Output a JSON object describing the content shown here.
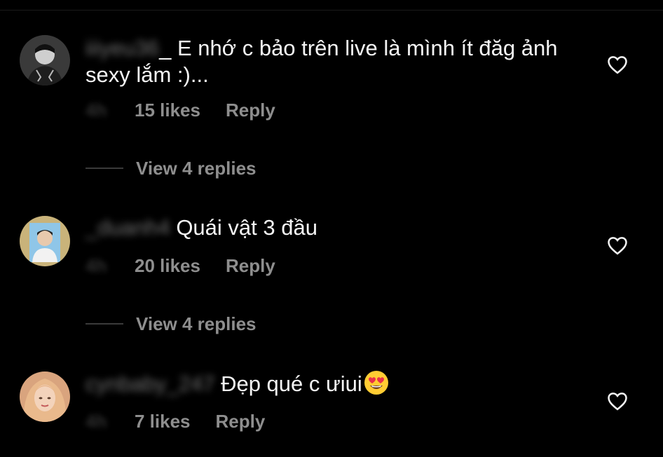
{
  "comments": [
    {
      "username": "iiiyeu36",
      "username_suffix": "_",
      "text": "E nhớ c bảo trên live là mình ít đăg ảnh sexy lắm :)...",
      "time": "4h",
      "likes": "15 likes",
      "reply": "Reply",
      "view_replies": "View 4 replies"
    },
    {
      "username": "_duanh4",
      "text": "Quái vật 3 đầu",
      "time": "4h",
      "likes": "20 likes",
      "reply": "Reply",
      "view_replies": "View 4 replies"
    },
    {
      "username": "cynbaby_247",
      "text": "Đẹp qué c ưiui",
      "emoji": "heart-eyes-emoji",
      "time": "4h",
      "likes": "7 likes",
      "reply": "Reply"
    }
  ],
  "colors": {
    "background": "#000000",
    "text": "#f5f5f5",
    "meta": "#8e8e8e"
  },
  "icons": [
    "heart-outline-icon",
    "heart-eyes-emoji"
  ]
}
